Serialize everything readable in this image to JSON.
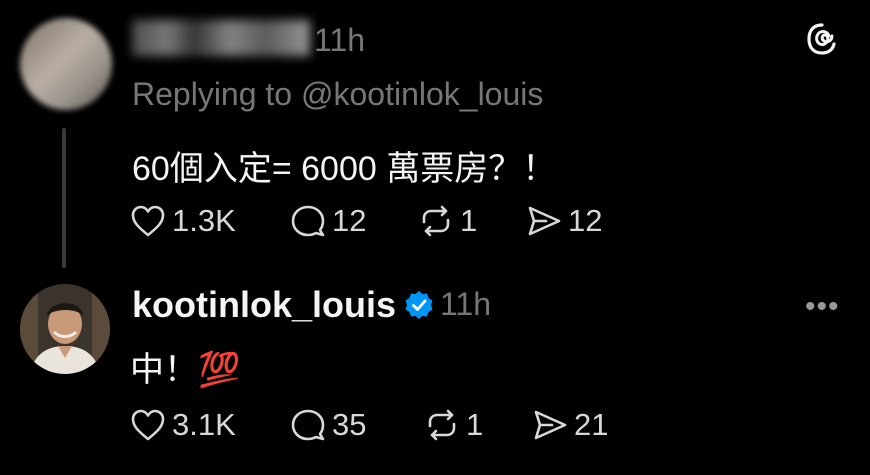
{
  "post1": {
    "time": "11h",
    "replying_to": "Replying to @kootinlok_louis",
    "content": "60個入定= 6000 萬票房？！",
    "likes": "1.3K",
    "comments": "12",
    "reposts": "1",
    "shares": "12"
  },
  "post2": {
    "username": "kootinlok_louis",
    "time": "11h",
    "content": "中！💯",
    "likes": "3.1K",
    "comments": "35",
    "reposts": "1",
    "shares": "21",
    "more": "•••"
  },
  "icons": {
    "app_logo": "threads-logo",
    "like": "heart-icon",
    "comment": "comment-bubble-icon",
    "repost": "repost-icon",
    "share": "send-icon",
    "verified": "verified-badge-icon"
  },
  "colors": {
    "background": "#000000",
    "text_primary": "#f3f5f7",
    "text_secondary": "#777777",
    "verified": "#0095f6"
  }
}
